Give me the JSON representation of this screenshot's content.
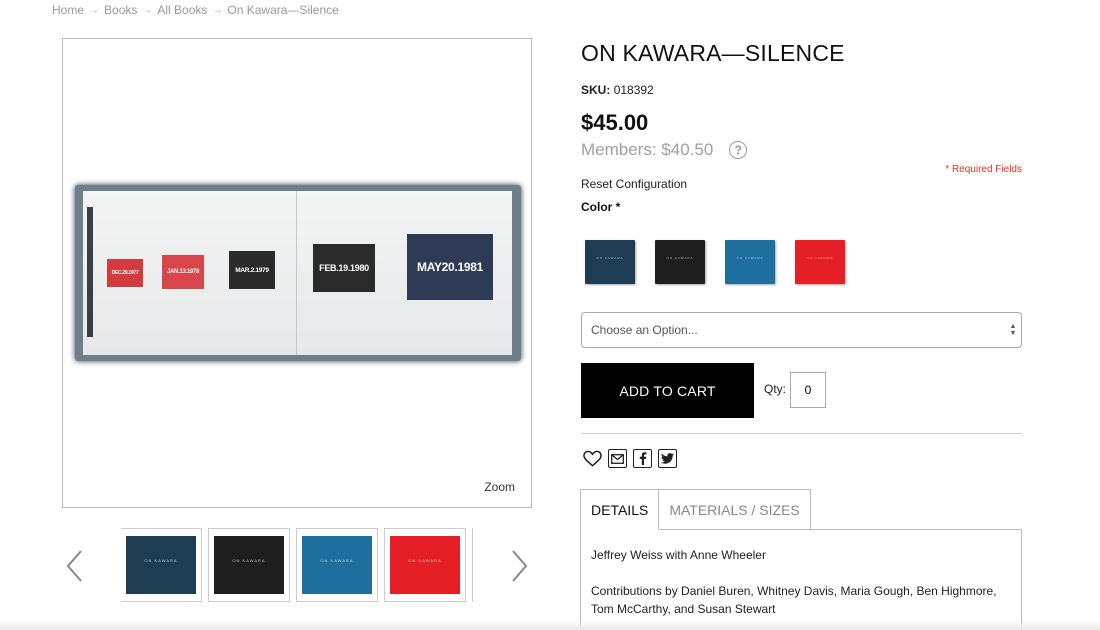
{
  "breadcrumb": [
    "Home",
    "Books",
    "All Books",
    "On Kawara—Silence"
  ],
  "breadcrumb_separator": "→",
  "gallery": {
    "zoom_label": "Zoom",
    "spread_dates": [
      "DEC.29.1977",
      "JAN.13.1978",
      "MAR.2.1979",
      "FEB.19.1980",
      "MAY20.1981"
    ],
    "spread_card_colors": [
      "#d13c3f",
      "#d8464a",
      "#2a2a2a",
      "#2b2b2b",
      "#2f3a55"
    ],
    "thumbnails": [
      {
        "color": "#1f3d52",
        "label": "ON KAWARA"
      },
      {
        "color": "#1e1e1e",
        "label": "ON KAWARA"
      },
      {
        "color": "#1e6e9e",
        "label": "ON KAWARA"
      },
      {
        "color": "#e41f26",
        "label": "ON KAWARA"
      }
    ]
  },
  "product": {
    "title": "ON KAWARA—SILENCE",
    "sku_label": "SKU:",
    "sku": "018392",
    "price": "$45.00",
    "members_price": "Members: $40.50",
    "help_icon": "?",
    "required_fields": "* Required Fields",
    "reset_label": "Reset Configuration",
    "color_label": "Color *",
    "swatches": [
      {
        "name": "dark-blue",
        "color": "#1f3d52"
      },
      {
        "name": "black",
        "color": "#1e1e1e"
      },
      {
        "name": "blue",
        "color": "#1e6e9e"
      },
      {
        "name": "red",
        "color": "#e41f26"
      }
    ],
    "select_placeholder": "Choose an Option...",
    "add_to_cart": "ADD TO CART",
    "qty_label": "Qty:",
    "qty_value": "0"
  },
  "tabs": [
    {
      "label": "DETAILS",
      "active": true
    },
    {
      "label": "MATERIALS / SIZES",
      "active": false
    }
  ],
  "details": {
    "line1": "Jeffrey Weiss with Anne Wheeler",
    "line2": "Contributions by Daniel Buren, Whitney Davis, Maria Gough, Ben Highmore, Tom McCarthy, and Susan Stewart"
  }
}
